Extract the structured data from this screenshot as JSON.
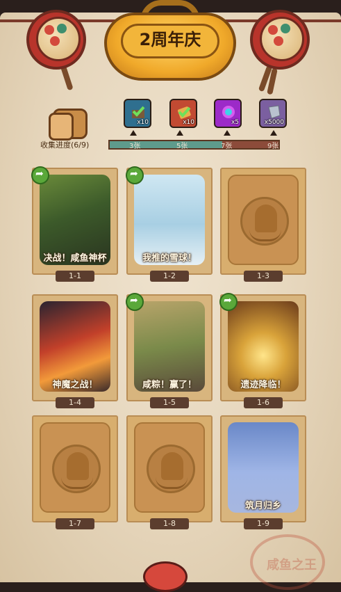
{
  "header": {
    "title": "2周年庆"
  },
  "progress": {
    "label": "收集进度(6/9)",
    "collected": 6,
    "total": 9,
    "ticks": [
      "3张",
      "5张",
      "7张",
      "9张"
    ],
    "rewards": [
      {
        "icon": "chest-check-icon",
        "qty": "x10",
        "color": "#2f6f8f"
      },
      {
        "icon": "ticket-check-icon",
        "qty": "x10",
        "color": "#c24a32"
      },
      {
        "icon": "magic-orb-icon",
        "qty": "x5",
        "color": "#9c2ac8"
      },
      {
        "icon": "crystal-icon",
        "qty": "x5000",
        "color": "#7b5fa0"
      }
    ],
    "colors": {
      "done": "#5e9b8c",
      "pending": "#8c4b3a"
    }
  },
  "cards": [
    {
      "id": "1-1",
      "title": "决战！咸鱼神杯",
      "unlocked": true,
      "shared": true
    },
    {
      "id": "1-2",
      "title": "我推的雪球！",
      "unlocked": true,
      "shared": true
    },
    {
      "id": "1-3",
      "title": "",
      "unlocked": false,
      "shared": false
    },
    {
      "id": "1-4",
      "title": "神魔之战！",
      "unlocked": true,
      "shared": false
    },
    {
      "id": "1-5",
      "title": "咸粽！赢了！",
      "unlocked": true,
      "shared": true
    },
    {
      "id": "1-6",
      "title": "遗迹降临！",
      "unlocked": true,
      "shared": true
    },
    {
      "id": "1-7",
      "title": "",
      "unlocked": false,
      "shared": false
    },
    {
      "id": "1-8",
      "title": "",
      "unlocked": false,
      "shared": false
    },
    {
      "id": "1-9",
      "title": "筑月归乡",
      "unlocked": true,
      "shared": false
    }
  ]
}
